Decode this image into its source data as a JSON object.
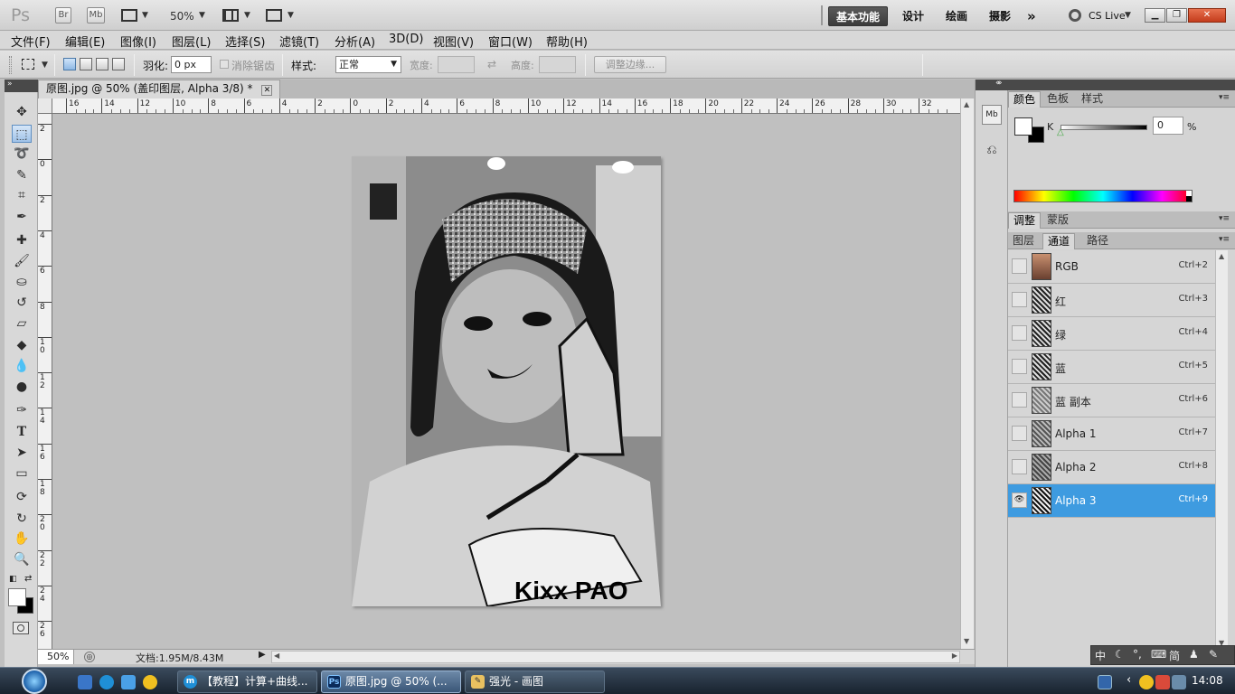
{
  "app": {
    "logo": "Ps",
    "bridge_label": "Br",
    "minibridge_label": "Mb",
    "zoom_level": "50%",
    "workspaces": [
      "基本功能",
      "设计",
      "绘画",
      "摄影"
    ],
    "active_workspace": "基本功能",
    "more_workspaces": "»",
    "cs_live": "CS Live"
  },
  "menu": [
    "文件(F)",
    "编辑(E)",
    "图像(I)",
    "图层(L)",
    "选择(S)",
    "滤镜(T)",
    "分析(A)",
    "3D(D)",
    "视图(V)",
    "窗口(W)",
    "帮助(H)"
  ],
  "options": {
    "feather_label": "羽化:",
    "feather_value": "0 px",
    "antialias_label": "消除锯齿",
    "style_label": "样式:",
    "style_value": "正常",
    "width_label": "宽度:",
    "height_label": "高度:",
    "refine_edge": "调整边缘..."
  },
  "document": {
    "tab_title": "原图.jpg @ 50% (盖印图层, Alpha 3/8) *",
    "zoom": "50%",
    "doc_info": "文档:1.95M/8.43M",
    "image_text": "Kixx PAO",
    "h_ruler_labels": [
      "16",
      "14",
      "12",
      "10",
      "8",
      "6",
      "4",
      "2",
      "0",
      "2",
      "4",
      "6",
      "8",
      "10",
      "12",
      "14",
      "16",
      "18",
      "20",
      "22",
      "24",
      "26",
      "28",
      "30",
      "32"
    ],
    "v_ruler_labels": [
      "2",
      "0",
      "2",
      "4",
      "6",
      "8",
      "10",
      "12",
      "14",
      "16",
      "18",
      "20",
      "22",
      "24",
      "26"
    ]
  },
  "panels": {
    "color_tabs": [
      "颜色",
      "色板",
      "样式"
    ],
    "color_channel": "K",
    "color_value": "0",
    "color_unit": "%",
    "adjust_tabs": [
      "调整",
      "蒙版"
    ],
    "layer_tabs": [
      "图层",
      "通道",
      "路径"
    ],
    "channels": [
      {
        "name": "RGB",
        "shortcut": "Ctrl+2"
      },
      {
        "name": "红",
        "shortcut": "Ctrl+3"
      },
      {
        "name": "绿",
        "shortcut": "Ctrl+4"
      },
      {
        "name": "蓝",
        "shortcut": "Ctrl+5"
      },
      {
        "name": "蓝 副本",
        "shortcut": "Ctrl+6"
      },
      {
        "name": "Alpha 1",
        "shortcut": "Ctrl+7"
      },
      {
        "name": "Alpha 2",
        "shortcut": "Ctrl+8"
      },
      {
        "name": "Alpha 3",
        "shortcut": "Ctrl+9"
      }
    ],
    "selected_channel": "Alpha 3",
    "ime_chars": [
      "中",
      "简"
    ]
  },
  "taskbar": {
    "tasks": [
      {
        "label": "【教程】计算+曲线...",
        "icon": "m"
      },
      {
        "label": "原图.jpg @ 50% (...",
        "icon": "Ps"
      },
      {
        "label": "强光 - 画图",
        "icon": "✎"
      }
    ],
    "time": "14:08"
  },
  "colors": {
    "selection": "#3e9be0",
    "ps_blue": "#2a60b0",
    "taskbar": "#1f2a36"
  }
}
